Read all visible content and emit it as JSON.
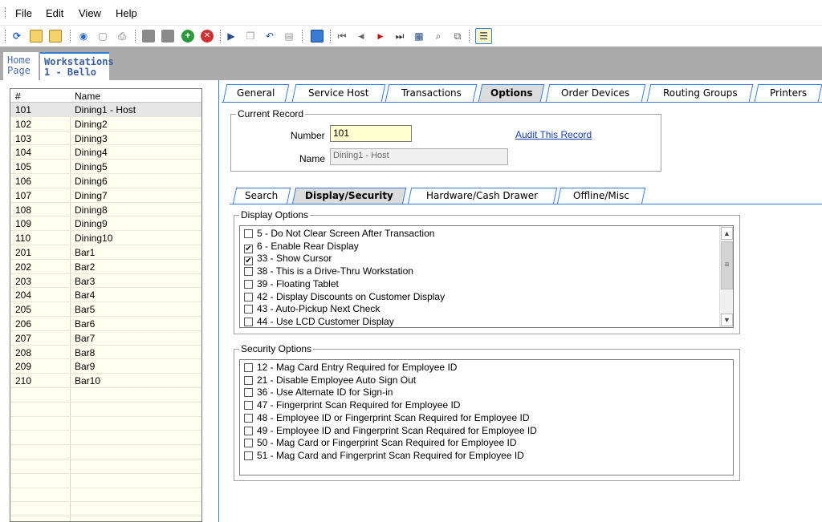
{
  "menu": [
    "File",
    "Edit",
    "View",
    "Help"
  ],
  "toolbar_icons": [
    "refresh-icon",
    "folder-open-icon",
    "folder-multi-icon",
    "record-icon",
    "note-icon",
    "print-icon",
    "save-icon",
    "save-all-icon",
    "add-icon",
    "delete-icon",
    "import-icon",
    "copy-icon",
    "undo-icon",
    "paste-icon",
    "report-icon",
    "first-record-icon",
    "previous-record-icon",
    "next-record-icon",
    "last-record-icon",
    "goto-record-icon",
    "find-icon",
    "find-replace-icon",
    "table-view-icon"
  ],
  "doc_tabs": {
    "home_line1": "Home",
    "home_line2": "Page",
    "ws_line1": "Workstations",
    "ws_line2": "1 - Bello"
  },
  "list": {
    "headers": [
      "#",
      "Name"
    ],
    "rows": [
      [
        "101",
        "Dining1 - Host"
      ],
      [
        "102",
        "Dining2"
      ],
      [
        "103",
        "Dining3"
      ],
      [
        "104",
        "Dining4"
      ],
      [
        "105",
        "Dining5"
      ],
      [
        "106",
        "Dining6"
      ],
      [
        "107",
        "Dining7"
      ],
      [
        "108",
        "Dining8"
      ],
      [
        "109",
        "Dining9"
      ],
      [
        "110",
        "Dining10"
      ],
      [
        "201",
        "Bar1"
      ],
      [
        "202",
        "Bar2"
      ],
      [
        "203",
        "Bar3"
      ],
      [
        "204",
        "Bar4"
      ],
      [
        "205",
        "Bar5"
      ],
      [
        "206",
        "Bar6"
      ],
      [
        "207",
        "Bar7"
      ],
      [
        "208",
        "Bar8"
      ],
      [
        "209",
        "Bar9"
      ],
      [
        "210",
        "Bar10"
      ]
    ],
    "selected_index": 0
  },
  "tabs": [
    "General",
    "Service Host",
    "Transactions",
    "Options",
    "Order Devices",
    "Routing Groups",
    "Printers"
  ],
  "active_tab": "Options",
  "current_record": {
    "legend": "Current Record",
    "number_label": "Number",
    "number_value": "101",
    "name_label": "Name",
    "name_value": "Dining1 - Host",
    "audit_link": "Audit This Record"
  },
  "subtabs": [
    "Search",
    "Display/Security",
    "Hardware/Cash Drawer",
    "Offline/Misc"
  ],
  "active_subtab": "Display/Security",
  "display_options": {
    "legend": "Display Options",
    "items": [
      {
        "label": "5 - Do Not Clear Screen After Transaction",
        "checked": false
      },
      {
        "label": "6 - Enable Rear Display",
        "checked": true
      },
      {
        "label": "33 - Show Cursor",
        "checked": true
      },
      {
        "label": "38 - This is a Drive-Thru Workstation",
        "checked": false
      },
      {
        "label": "39 - Floating Tablet",
        "checked": false
      },
      {
        "label": "42 - Display Discounts on Customer Display",
        "checked": false
      },
      {
        "label": "43 - Auto-Pickup Next Check",
        "checked": false
      },
      {
        "label": "44 - Use LCD Customer Display",
        "checked": false
      }
    ]
  },
  "security_options": {
    "legend": "Security Options",
    "items": [
      {
        "label": "12 - Mag Card Entry Required for Employee ID",
        "checked": false
      },
      {
        "label": "21 - Disable Employee Auto Sign Out",
        "checked": false
      },
      {
        "label": "36 - Use Alternate ID for Sign-in",
        "checked": false
      },
      {
        "label": "47 - Fingerprint Scan Required for Employee ID",
        "checked": false
      },
      {
        "label": "48 - Employee ID or Fingerprint Scan Required for Employee ID",
        "checked": false
      },
      {
        "label": "49 - Employee ID and Fingerprint Scan Required for Employee ID",
        "checked": false
      },
      {
        "label": "50 - Mag Card or Fingerprint Scan Required for Employee ID",
        "checked": false
      },
      {
        "label": "51 - Mag Card and Fingerprint Scan Required for Employee ID",
        "checked": false
      }
    ]
  },
  "colors": {
    "accent": "#3a7bd5",
    "list_bg": "#fffff0",
    "band": "#aaaaaa",
    "highlight_input": "#ffffd0"
  }
}
